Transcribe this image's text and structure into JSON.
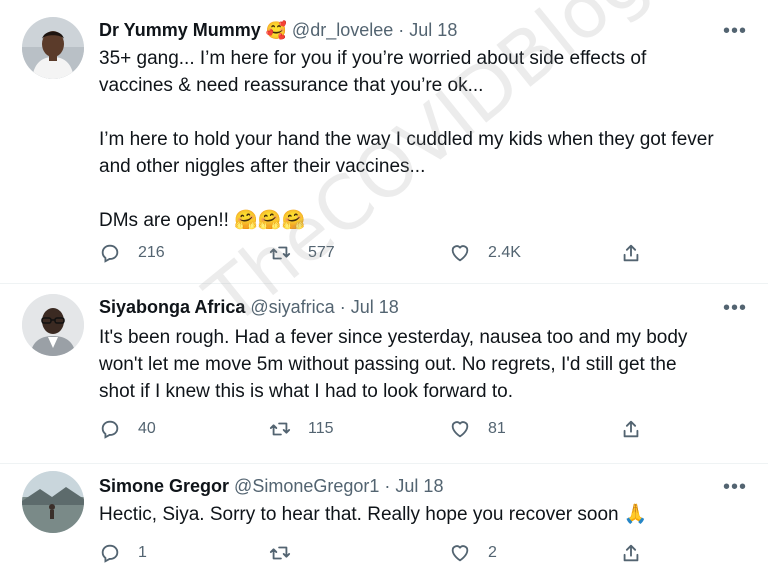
{
  "tweets": [
    {
      "display_name": "Dr Yummy Mummy",
      "name_emoji": "🥰",
      "handle": "@dr_lovelee",
      "separator": "·",
      "date": "Jul 18",
      "more": "•••",
      "text": "35+ gang... I’m here for you if you’re worried about side effects of\nvaccines & need reassurance that you’re ok...\n\nI’m here to hold your hand the way I cuddled my kids when they got fever\nand other niggles after their vaccines...\n\nDMs are open!! 🤗🤗🤗",
      "replies": "216",
      "retweets": "577",
      "likes": "2.4K"
    },
    {
      "display_name": "Siyabonga Africa",
      "handle": "@siyafrica",
      "separator": "·",
      "date": "Jul 18",
      "more": "•••",
      "text": "It's been rough. Had a fever since yesterday, nausea too and my body\nwon't let me move 5m without passing out. No regrets, I'd still get the\nshot if I knew this is what I had to look forward to.",
      "replies": "40",
      "retweets": "115",
      "likes": "81"
    },
    {
      "display_name": "Simone Gregor",
      "handle": "@SimoneGregor1",
      "separator": "·",
      "date": "Jul 18",
      "more": "•••",
      "text": "Hectic, Siya. Sorry to hear that. Really hope you recover soon 🙏",
      "replies": "1",
      "retweets": "",
      "likes": "2"
    }
  ],
  "watermark": "TheCOVIDBlog.com",
  "colors": {
    "text": "#0f1419",
    "secondary": "#536471",
    "divider": "#eff3f4"
  }
}
